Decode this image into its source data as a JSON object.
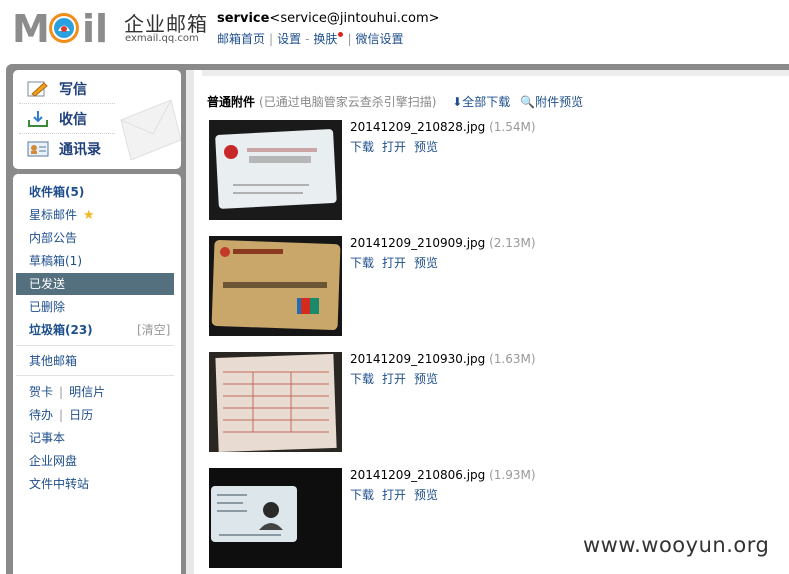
{
  "brand": {
    "logo_cn": "企业邮箱",
    "logo_sub": "exmail.qq.com"
  },
  "account": {
    "name": "service",
    "email": "<service@jintouhui.com>"
  },
  "top_links": [
    "邮箱首页",
    "设置",
    "换肤",
    "微信设置"
  ],
  "compose": {
    "write": "写信",
    "receive": "收信",
    "contacts": "通讯录"
  },
  "sidebar": {
    "inbox": "收件箱(5)",
    "starred": "星标邮件",
    "notice": "内部公告",
    "drafts": "草稿箱(1)",
    "sent": "已发送",
    "deleted": "已删除",
    "spam": "垃圾箱(23)",
    "spam_clear": "[清空]",
    "other": "其他邮箱",
    "card": "贺卡",
    "postcard": "明信片",
    "todo": "待办",
    "calendar": "日历",
    "notes": "记事本",
    "disk": "企业网盘",
    "transfer": "文件中转站"
  },
  "attachments": {
    "title": "普通附件",
    "note": "(已通过电脑管家云查杀引擎扫描)",
    "download_all": "全部下载",
    "preview_all": "附件预览",
    "items": [
      {
        "name": "20141209_210828.jpg",
        "size": "(1.54M)",
        "actions": [
          "下载",
          "打开",
          "预览"
        ]
      },
      {
        "name": "20141209_210909.jpg",
        "size": "(2.13M)",
        "actions": [
          "下载",
          "打开",
          "预览"
        ]
      },
      {
        "name": "20141209_210930.jpg",
        "size": "(1.63M)",
        "actions": [
          "下载",
          "打开",
          "预览"
        ]
      },
      {
        "name": "20141209_210806.jpg",
        "size": "(1.93M)",
        "actions": [
          "下载",
          "打开",
          "预览"
        ]
      }
    ]
  },
  "watermark": "www.wooyun.org",
  "colors": {
    "link": "#1e4f8c",
    "selected": "#54707e",
    "frame": "#8a8a8a"
  }
}
